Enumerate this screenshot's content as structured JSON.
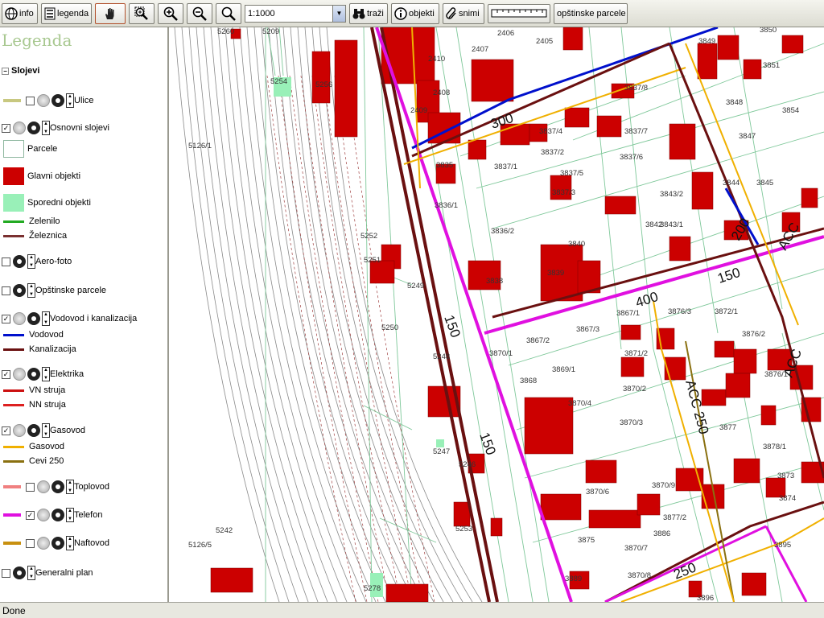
{
  "toolbar": {
    "info_label": "info",
    "legenda_label": "legenda",
    "scale_value": "1:1000",
    "trazi_label": "traži",
    "objekti_label": "objekti",
    "snimi_label": "snimi",
    "parcele_label": "opštinske parcele"
  },
  "legend": {
    "title": "Legenda",
    "slojevi": "Slojevi",
    "layers": {
      "ulice": "Ulice",
      "osnovni": "Osnovni slojevi",
      "parcele": "Parcele",
      "glavni": "Glavni objekti",
      "sporedni": "Sporedni objekti",
      "zelenilo": "Zelenilo",
      "zeleznica": "Železnica",
      "aero": "Aero-foto",
      "opstinske": "Opštinske parcele",
      "vodovod_group": "Vodovod i kanalizacija",
      "vodovod": "Vodovod",
      "kanalizacija": "Kanalizacija",
      "elektrika": "Elektrika",
      "vn": "VN struja",
      "nn": "NN struja",
      "gasovod_group": "Gasovod",
      "gasovod": "Gasovod",
      "cevi": "Cevi 250",
      "toplovod": "Toplovod",
      "telefon": "Telefon",
      "naftovod": "Naftovod",
      "generalni": "Generalni plan"
    },
    "colors": {
      "ulice": "#c8c880",
      "glavni": "#cc0000",
      "sporedni": "#99f0b8",
      "zelenilo": "#22aa22",
      "zeleznica": "#7a3030",
      "vodovod": "#0010cc",
      "kanalizacija": "#6a1010",
      "vn": "#cc1010",
      "nn": "#dd2020",
      "gasovod": "#f0b000",
      "cevi": "#8a7010",
      "toplovod": "#f08080",
      "telefon": "#e010e0",
      "naftovod": "#c89010"
    }
  },
  "map": {
    "parcel_labels": [
      "5260",
      "5209",
      "5254",
      "5256",
      "5126/1",
      "5252",
      "5251",
      "5249",
      "5250",
      "5248",
      "5247",
      "5246",
      "5242",
      "5126/5",
      "5278",
      "5253",
      "2410",
      "2407",
      "2406",
      "2405",
      "2408",
      "2409",
      "3849",
      "3850",
      "3851",
      "3848",
      "3854",
      "3847",
      "3845",
      "3844",
      "3837/8",
      "3837/7",
      "3837/4",
      "3837/2",
      "3837/6",
      "3837/5",
      "3837/3",
      "3835",
      "3837/1",
      "3836/1",
      "3836/2",
      "3843/2",
      "3842",
      "3843/1",
      "3840",
      "3839",
      "3838",
      "3867/1",
      "3876/3",
      "3872/1",
      "3867/3",
      "3867/2",
      "3870/1",
      "3871/2",
      "3876/2",
      "3869/1",
      "3868",
      "3870/2",
      "3876/1",
      "3870/4",
      "3870/3",
      "3877",
      "3878/1",
      "3873",
      "3870/6",
      "3870/9",
      "3877/2",
      "3874",
      "3875",
      "3870/7",
      "3870/8",
      "3886",
      "3895",
      "3889",
      "3896"
    ],
    "pipe_labels": [
      "300",
      "200",
      "ACC",
      "150",
      "400",
      "150",
      "ACC",
      "ACC 250",
      "150",
      "250"
    ]
  },
  "status": {
    "text": "Done"
  }
}
